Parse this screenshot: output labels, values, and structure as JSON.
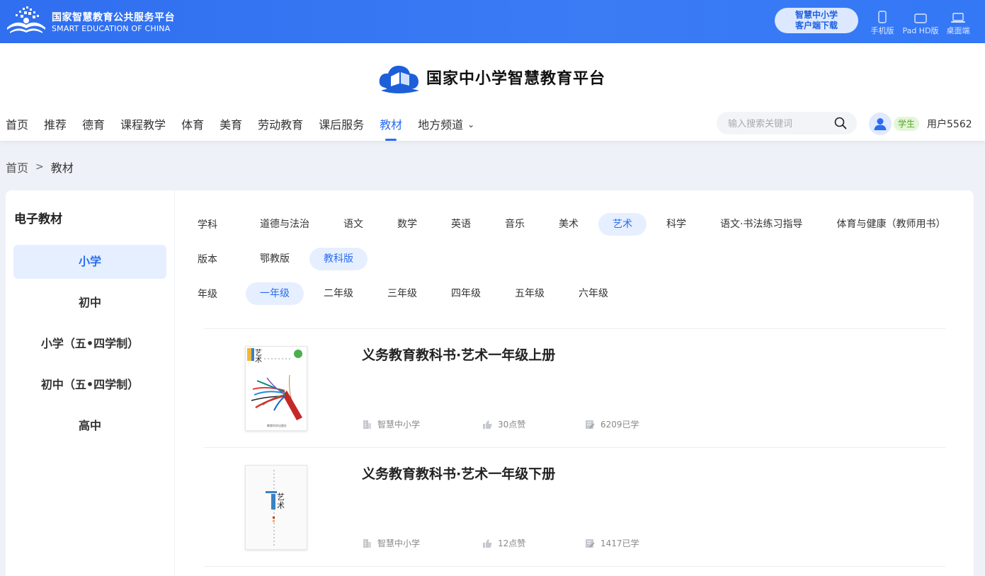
{
  "topbar": {
    "title_cn": "国家智慧教育公共服务平台",
    "title_en": "SMART EDUCATION OF CHINA",
    "download_line1": "智慧中小学",
    "download_line2": "客户端下载",
    "devices": [
      {
        "label": "手机版",
        "icon": "phone-icon"
      },
      {
        "label": "Pad HD版",
        "icon": "tablet-icon"
      },
      {
        "label": "桌面端",
        "icon": "laptop-icon"
      }
    ]
  },
  "header": {
    "brand_title": "国家中小学智慧教育平台",
    "nav": [
      "首页",
      "推荐",
      "德育",
      "课程教学",
      "体育",
      "美育",
      "劳动教育",
      "课后服务",
      "教材",
      "地方频道"
    ],
    "active_nav": "教材",
    "search_placeholder": "输入搜索关键词",
    "role_badge": "学生",
    "username": "用户5562"
  },
  "breadcrumb": {
    "home": "首页",
    "separator": ">",
    "current": "教材"
  },
  "sidebar": {
    "title": "电子教材",
    "items": [
      "小学",
      "初中",
      "小学（五•四学制）",
      "初中（五•四学制）",
      "高中"
    ],
    "active": "小学"
  },
  "filters": {
    "subject": {
      "label": "学科",
      "options": [
        "道德与法治",
        "语文",
        "数学",
        "英语",
        "音乐",
        "美术",
        "艺术",
        "科学",
        "语文·书法练习指导",
        "体育与健康（教师用书）"
      ],
      "active": "艺术"
    },
    "edition": {
      "label": "版本",
      "options": [
        "鄂教版",
        "教科版"
      ],
      "active": "教科版"
    },
    "grade": {
      "label": "年级",
      "options": [
        "一年级",
        "二年级",
        "三年级",
        "四年级",
        "五年级",
        "六年级"
      ],
      "active": "一年级"
    }
  },
  "books": [
    {
      "title": "义务教育教科书·艺术一年级上册",
      "publisher": "智慧中小学",
      "likes": "30点赞",
      "learned": "6209已学"
    },
    {
      "title": "义务教育教科书·艺术一年级下册",
      "publisher": "智慧中小学",
      "likes": "12点赞",
      "learned": "1417已学"
    }
  ],
  "colors": {
    "brand_blue": "#2a6df0",
    "topbar_blue": "#3478f6",
    "active_bg": "#e6efff",
    "role_green": "#5aa12a"
  }
}
